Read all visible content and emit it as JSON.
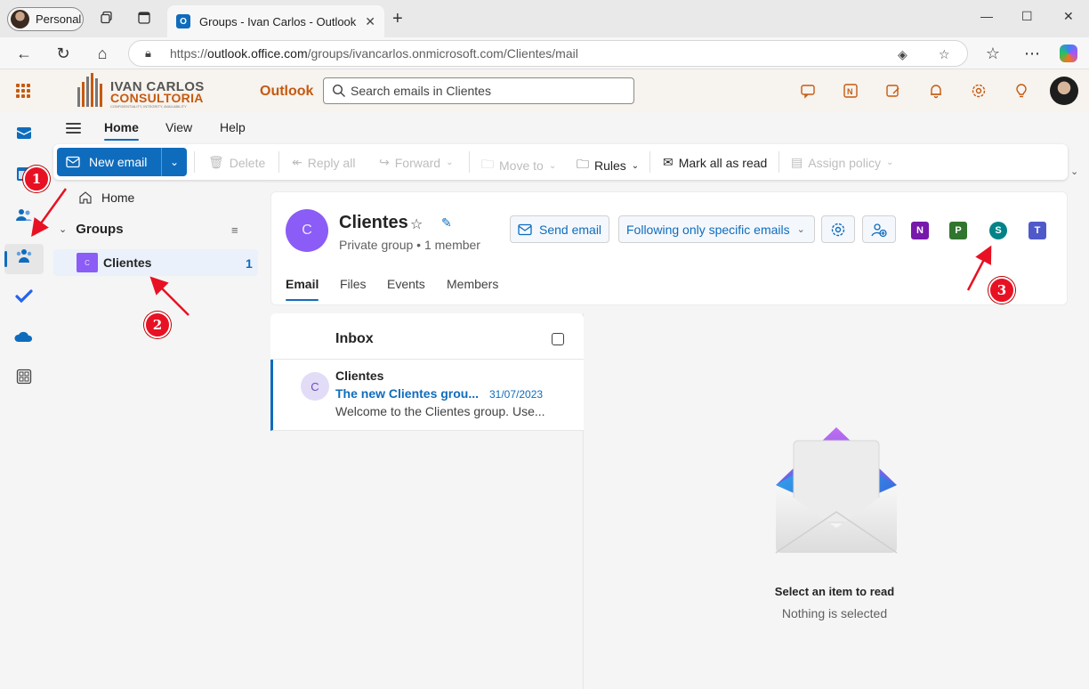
{
  "browser": {
    "profile_label": "Personal",
    "tab_title": "Groups - Ivan Carlos - Outlook",
    "url_prefix": "https://",
    "url_host": "outlook.office.com",
    "url_path": "/groups/ivancarlos.onmicrosoft.com/Clientes/mail"
  },
  "header": {
    "logo_line1": "IVAN CARLOS",
    "logo_line2": "CONSULTORIA",
    "logo_tagline": "CONFIDENTIALITY, INTEGRITY, AVAILABILITY",
    "app_name": "Outlook",
    "search_placeholder": "Search emails in Clientes",
    "accent": "#c55a11"
  },
  "ribbon": {
    "tabs": [
      "Home",
      "View",
      "Help"
    ],
    "new_email": "New email",
    "delete": "Delete",
    "reply_all": "Reply all",
    "forward": "Forward",
    "move_to": "Move to",
    "rules": "Rules",
    "mark_all_read": "Mark all as read",
    "assign_policy": "Assign policy"
  },
  "folders": {
    "home": "Home",
    "groups_heading": "Groups",
    "group_chip": "C",
    "group_name": "Clientes",
    "group_count": "1"
  },
  "group": {
    "avatar_letter": "C",
    "name": "Clientes",
    "subtitle": "Private group • 1 member",
    "send_email": "Send email",
    "following": "Following only specific emails",
    "tabs": [
      "Email",
      "Files",
      "Events",
      "Members"
    ]
  },
  "message_list": {
    "title": "Inbox",
    "items": [
      {
        "avatar": "C",
        "from": "Clientes",
        "subject": "The new Clientes grou...",
        "date": "31/07/2023",
        "preview": "Welcome to the Clientes group. Use..."
      }
    ]
  },
  "reading_pane": {
    "title": "Select an item to read",
    "subtitle": "Nothing is selected"
  },
  "annotations": [
    "1",
    "2",
    "3"
  ],
  "colors": {
    "brand_blue": "#0f6cbd",
    "group_purple": "#8b5cf6",
    "annotation_red": "#e81123"
  }
}
